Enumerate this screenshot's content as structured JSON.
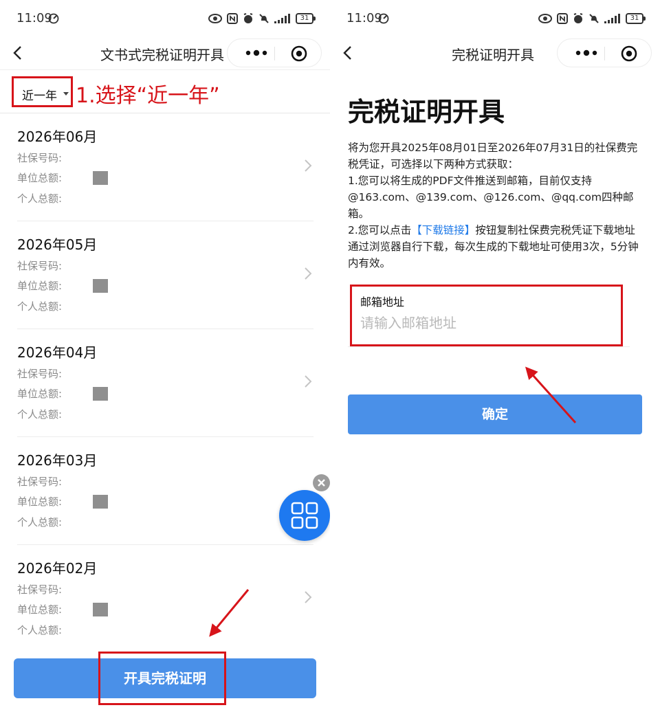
{
  "status_bar": {
    "time": "11:09",
    "battery": "31"
  },
  "left": {
    "nav_title": "文书式完税证明开具",
    "filter_selected": "近一年",
    "annotation": "1.选择“近一年”",
    "field_labels": {
      "social_no": "社保号码:",
      "unit_total": "单位总额:",
      "personal_total": "个人总额:"
    },
    "records": [
      {
        "month": "2026年06月"
      },
      {
        "month": "2026年05月"
      },
      {
        "month": "2026年04月"
      },
      {
        "month": "2026年03月"
      },
      {
        "month": "2026年02月"
      }
    ],
    "issue_button": "开具完税证明"
  },
  "right": {
    "nav_title": "完税证明开具",
    "heading": "完税证明开具",
    "intro_line1": "将为您开具2025年08月01日至2026年07月31日的社保费完税凭证，可选择以下两种方式获取：",
    "intro_line2": "1.您可以将生成的PDF文件推送到邮箱，目前仅支持@163.com、@139.com、@126.com、@qq.com四种邮箱。",
    "intro_line3_pre": "2.您可以点击",
    "intro_link": "【下载链接】",
    "intro_line3_post": "按钮复制社保费完税凭证下载地址通过浏览器自行下载，每次生成的下载地址可使用3次，5分钟内有效。",
    "email_label": "邮箱地址",
    "email_placeholder": "请输入邮箱地址",
    "email_value": "",
    "confirm_button": "确定"
  },
  "colors": {
    "primary_button": "#4a90e8",
    "annotation_red": "#d7141a",
    "link_blue": "#1f7ae8",
    "float_button": "#1e79f0"
  }
}
